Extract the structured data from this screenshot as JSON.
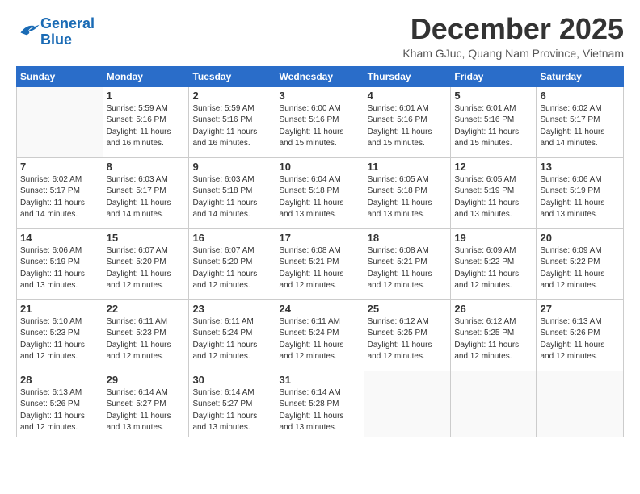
{
  "logo": {
    "line1": "General",
    "line2": "Blue"
  },
  "title": "December 2025",
  "subtitle": "Kham GJuc, Quang Nam Province, Vietnam",
  "weekdays": [
    "Sunday",
    "Monday",
    "Tuesday",
    "Wednesday",
    "Thursday",
    "Friday",
    "Saturday"
  ],
  "weeks": [
    [
      {
        "day": "",
        "info": ""
      },
      {
        "day": "1",
        "info": "Sunrise: 5:59 AM\nSunset: 5:16 PM\nDaylight: 11 hours\nand 16 minutes."
      },
      {
        "day": "2",
        "info": "Sunrise: 5:59 AM\nSunset: 5:16 PM\nDaylight: 11 hours\nand 16 minutes."
      },
      {
        "day": "3",
        "info": "Sunrise: 6:00 AM\nSunset: 5:16 PM\nDaylight: 11 hours\nand 15 minutes."
      },
      {
        "day": "4",
        "info": "Sunrise: 6:01 AM\nSunset: 5:16 PM\nDaylight: 11 hours\nand 15 minutes."
      },
      {
        "day": "5",
        "info": "Sunrise: 6:01 AM\nSunset: 5:16 PM\nDaylight: 11 hours\nand 15 minutes."
      },
      {
        "day": "6",
        "info": "Sunrise: 6:02 AM\nSunset: 5:17 PM\nDaylight: 11 hours\nand 14 minutes."
      }
    ],
    [
      {
        "day": "7",
        "info": "Sunrise: 6:02 AM\nSunset: 5:17 PM\nDaylight: 11 hours\nand 14 minutes."
      },
      {
        "day": "8",
        "info": "Sunrise: 6:03 AM\nSunset: 5:17 PM\nDaylight: 11 hours\nand 14 minutes."
      },
      {
        "day": "9",
        "info": "Sunrise: 6:03 AM\nSunset: 5:18 PM\nDaylight: 11 hours\nand 14 minutes."
      },
      {
        "day": "10",
        "info": "Sunrise: 6:04 AM\nSunset: 5:18 PM\nDaylight: 11 hours\nand 13 minutes."
      },
      {
        "day": "11",
        "info": "Sunrise: 6:05 AM\nSunset: 5:18 PM\nDaylight: 11 hours\nand 13 minutes."
      },
      {
        "day": "12",
        "info": "Sunrise: 6:05 AM\nSunset: 5:19 PM\nDaylight: 11 hours\nand 13 minutes."
      },
      {
        "day": "13",
        "info": "Sunrise: 6:06 AM\nSunset: 5:19 PM\nDaylight: 11 hours\nand 13 minutes."
      }
    ],
    [
      {
        "day": "14",
        "info": "Sunrise: 6:06 AM\nSunset: 5:19 PM\nDaylight: 11 hours\nand 13 minutes."
      },
      {
        "day": "15",
        "info": "Sunrise: 6:07 AM\nSunset: 5:20 PM\nDaylight: 11 hours\nand 12 minutes."
      },
      {
        "day": "16",
        "info": "Sunrise: 6:07 AM\nSunset: 5:20 PM\nDaylight: 11 hours\nand 12 minutes."
      },
      {
        "day": "17",
        "info": "Sunrise: 6:08 AM\nSunset: 5:21 PM\nDaylight: 11 hours\nand 12 minutes."
      },
      {
        "day": "18",
        "info": "Sunrise: 6:08 AM\nSunset: 5:21 PM\nDaylight: 11 hours\nand 12 minutes."
      },
      {
        "day": "19",
        "info": "Sunrise: 6:09 AM\nSunset: 5:22 PM\nDaylight: 11 hours\nand 12 minutes."
      },
      {
        "day": "20",
        "info": "Sunrise: 6:09 AM\nSunset: 5:22 PM\nDaylight: 11 hours\nand 12 minutes."
      }
    ],
    [
      {
        "day": "21",
        "info": "Sunrise: 6:10 AM\nSunset: 5:23 PM\nDaylight: 11 hours\nand 12 minutes."
      },
      {
        "day": "22",
        "info": "Sunrise: 6:11 AM\nSunset: 5:23 PM\nDaylight: 11 hours\nand 12 minutes."
      },
      {
        "day": "23",
        "info": "Sunrise: 6:11 AM\nSunset: 5:24 PM\nDaylight: 11 hours\nand 12 minutes."
      },
      {
        "day": "24",
        "info": "Sunrise: 6:11 AM\nSunset: 5:24 PM\nDaylight: 11 hours\nand 12 minutes."
      },
      {
        "day": "25",
        "info": "Sunrise: 6:12 AM\nSunset: 5:25 PM\nDaylight: 11 hours\nand 12 minutes."
      },
      {
        "day": "26",
        "info": "Sunrise: 6:12 AM\nSunset: 5:25 PM\nDaylight: 11 hours\nand 12 minutes."
      },
      {
        "day": "27",
        "info": "Sunrise: 6:13 AM\nSunset: 5:26 PM\nDaylight: 11 hours\nand 12 minutes."
      }
    ],
    [
      {
        "day": "28",
        "info": "Sunrise: 6:13 AM\nSunset: 5:26 PM\nDaylight: 11 hours\nand 12 minutes."
      },
      {
        "day": "29",
        "info": "Sunrise: 6:14 AM\nSunset: 5:27 PM\nDaylight: 11 hours\nand 13 minutes."
      },
      {
        "day": "30",
        "info": "Sunrise: 6:14 AM\nSunset: 5:27 PM\nDaylight: 11 hours\nand 13 minutes."
      },
      {
        "day": "31",
        "info": "Sunrise: 6:14 AM\nSunset: 5:28 PM\nDaylight: 11 hours\nand 13 minutes."
      },
      {
        "day": "",
        "info": ""
      },
      {
        "day": "",
        "info": ""
      },
      {
        "day": "",
        "info": ""
      }
    ]
  ]
}
